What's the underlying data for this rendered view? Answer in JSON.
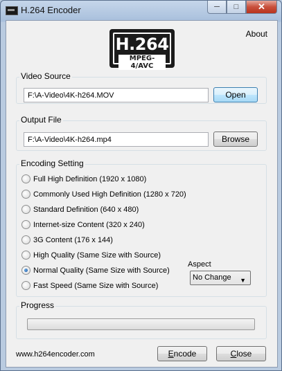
{
  "window": {
    "title": "H.264 Encoder",
    "controls": {
      "minimize": "─",
      "maximize": "□",
      "close": "✕"
    }
  },
  "logo": {
    "main": "H.264",
    "sub": "MPEG-4/AVC"
  },
  "menu": {
    "about": "About"
  },
  "video_source": {
    "label": "Video Source",
    "value": "F:\\A-Video\\4K-h264.MOV",
    "button": "Open"
  },
  "output_file": {
    "label": "Output File",
    "value": "F:\\A-Video\\4K-h264.mp4",
    "button": "Browse"
  },
  "encoding": {
    "label": "Encoding Setting",
    "options": [
      {
        "label": "Full High Definition (1920 x 1080)",
        "checked": false
      },
      {
        "label": "Commonly Used High Definition (1280 x 720)",
        "checked": false
      },
      {
        "label": "Standard Definition (640 x 480)",
        "checked": false
      },
      {
        "label": "Internet-size Content (320 x 240)",
        "checked": false
      },
      {
        "label": "3G Content (176 x 144)",
        "checked": false
      },
      {
        "label": "High Quality (Same Size with Source)",
        "checked": false
      },
      {
        "label": "Normal Quality (Same Size with Source)",
        "checked": true
      },
      {
        "label": "Fast Speed (Same Size with Source)",
        "checked": false
      }
    ]
  },
  "aspect": {
    "label": "Aspect",
    "selected": "No Change"
  },
  "progress": {
    "label": "Progress",
    "value_percent": 0
  },
  "footer": {
    "website": "www.h264encoder.com",
    "encode_first": "E",
    "encode_rest": "ncode",
    "close_first": "C",
    "close_rest": "lose"
  },
  "colors": {
    "accent": "#3c7fb1",
    "close_button": "#c8503c",
    "progress_fill": "#37a02f"
  }
}
